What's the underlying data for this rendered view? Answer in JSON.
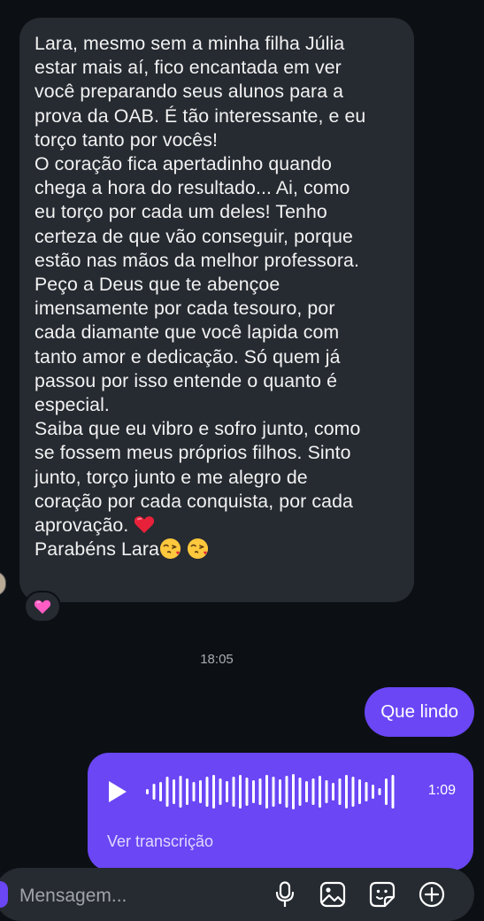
{
  "incoming_message": {
    "lines": [
      "Lara, mesmo sem a minha filha Júlia",
      "estar mais aí, fico encantada em ver",
      "você preparando seus alunos para a",
      "prova da OAB. É tão interessante, e eu",
      "torço tanto por vocês!",
      "O coração fica apertadinho quando",
      "chega a hora do resultado... Ai, como",
      "eu torço por cada um deles! Tenho",
      "certeza de que vão conseguir, porque",
      "estão nas mãos da melhor professora.",
      "Peço a Deus que te abençoe",
      "imensamente por cada tesouro, por",
      "cada diamante que você lapida com",
      "tanto amor e dedicação. Só quem já",
      "passou por isso entende o quanto é",
      "especial.",
      "Saiba que eu vibro e sofro junto, como",
      "se fossem meus próprios filhos. Sinto",
      "junto, torço junto e me alegro de",
      "coração por cada conquista, por cada",
      "aprovação.",
      "Parabéns Lara"
    ],
    "heart_emoji": "red-heart-icon",
    "kiss_emoji": "face-blowing-kiss-icon",
    "reaction": "pink-heart-icon"
  },
  "timestamp": "18:05",
  "outgoing_text": "Que lindo",
  "voice_message": {
    "duration": "1:09",
    "transcript_link": "Ver transcrição"
  },
  "composer": {
    "placeholder": "Mensagem...",
    "icons": [
      "microphone-icon",
      "gallery-icon",
      "sticker-icon",
      "plus-icon"
    ]
  },
  "colors": {
    "background": "#0c1014",
    "incoming_bubble": "#262a31",
    "outgoing_bubble": "#6a46f5"
  }
}
